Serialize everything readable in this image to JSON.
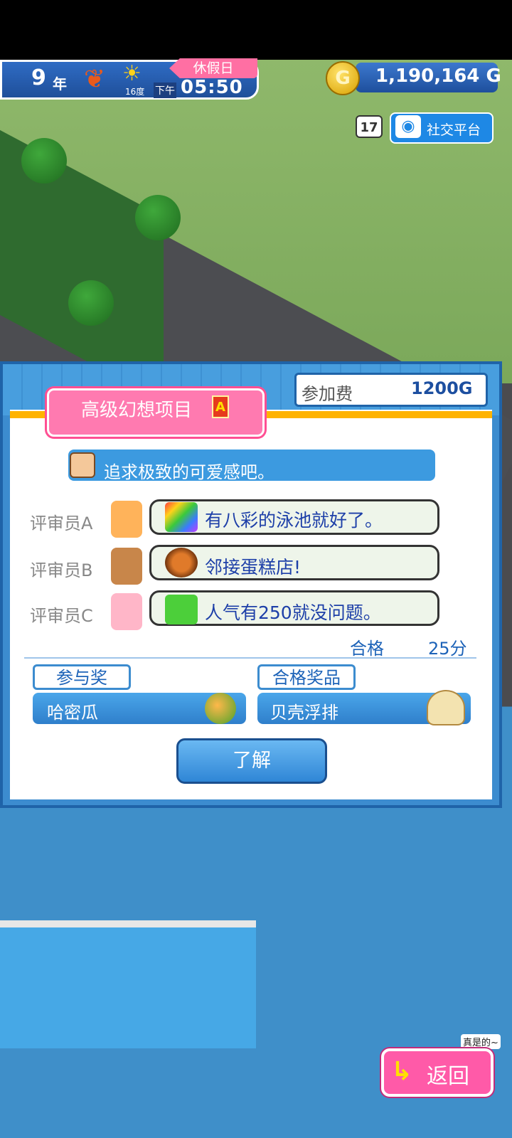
{
  "status_bar": {
    "year_number": "9",
    "year_unit": "年",
    "season_icon": "maple-leaf-icon",
    "weather_icon": "sun-icon",
    "temperature": "16度",
    "ampm": "下午",
    "time": "05:50",
    "day_type": "休假日",
    "money": "1,190,164 G",
    "coin_glyph": "G"
  },
  "top_right": {
    "rating_badge": "17",
    "social_label": "社交平台"
  },
  "dialog": {
    "fee_label": "参加费",
    "fee_value": "1200G",
    "title": "高级幻想项目",
    "rank": "A",
    "goal_text": "追求极致的可爱感吧。",
    "judges": [
      {
        "label": "评审员A",
        "comment": "有八彩的泳池就好了。"
      },
      {
        "label": "评审员B",
        "comment": "邻接蛋糕店!"
      },
      {
        "label": "评审员C",
        "comment": "人气有250就没问题。"
      }
    ],
    "pass_label": "合格",
    "pass_score": "25分",
    "participation_prize_label": "参与奖",
    "participation_prize": "哈密瓜",
    "pass_prize_label": "合格奖品",
    "pass_prize": "贝壳浮排",
    "ok_button": "了解"
  },
  "back_button": "返回",
  "speech_snippet": "真是的~"
}
